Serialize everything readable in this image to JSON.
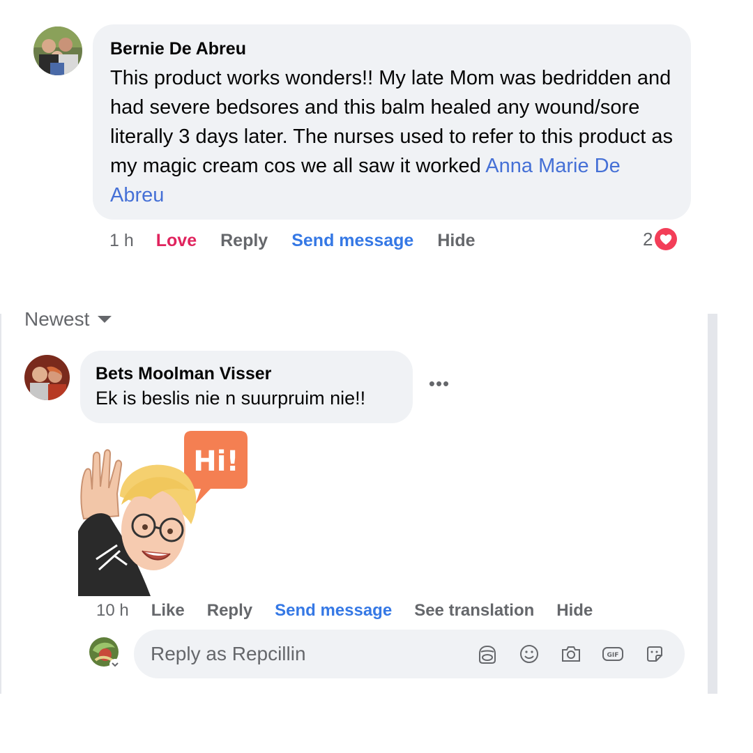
{
  "comment1": {
    "author": "Bernie De Abreu",
    "text": "This product works wonders!! My late Mom was bedridden and had severe bedsores and this balm healed any wound/sore literally 3 days later. The nurses used to refer to this product as my magic cream cos we all saw it worked",
    "mention": "Anna Marie De Abreu",
    "time": "1 h",
    "love_label": "Love",
    "reply_label": "Reply",
    "send_message_label": "Send message",
    "hide_label": "Hide",
    "reaction_count": "2",
    "reaction_icon": "heart-icon"
  },
  "panel2": {
    "sort_label": "Newest",
    "comment": {
      "author": "Bets Moolman Visser",
      "text": "Ek is beslis nie n suurpruim nie!!",
      "sticker_text": "Hi!",
      "time": "10 h",
      "like_label": "Like",
      "reply_label": "Reply",
      "send_message_label": "Send message",
      "see_translation_label": "See translation",
      "hide_label": "Hide"
    },
    "composer": {
      "placeholder": "Reply as Repcillin",
      "icons": [
        "avatar-sticker-icon",
        "emoji-icon",
        "camera-icon",
        "gif-icon",
        "sticker-icon"
      ]
    }
  },
  "colors": {
    "bubble": "#f0f2f5",
    "link_blue": "#3578e5",
    "love_red": "#e0245e",
    "muted_text": "#65676b"
  }
}
